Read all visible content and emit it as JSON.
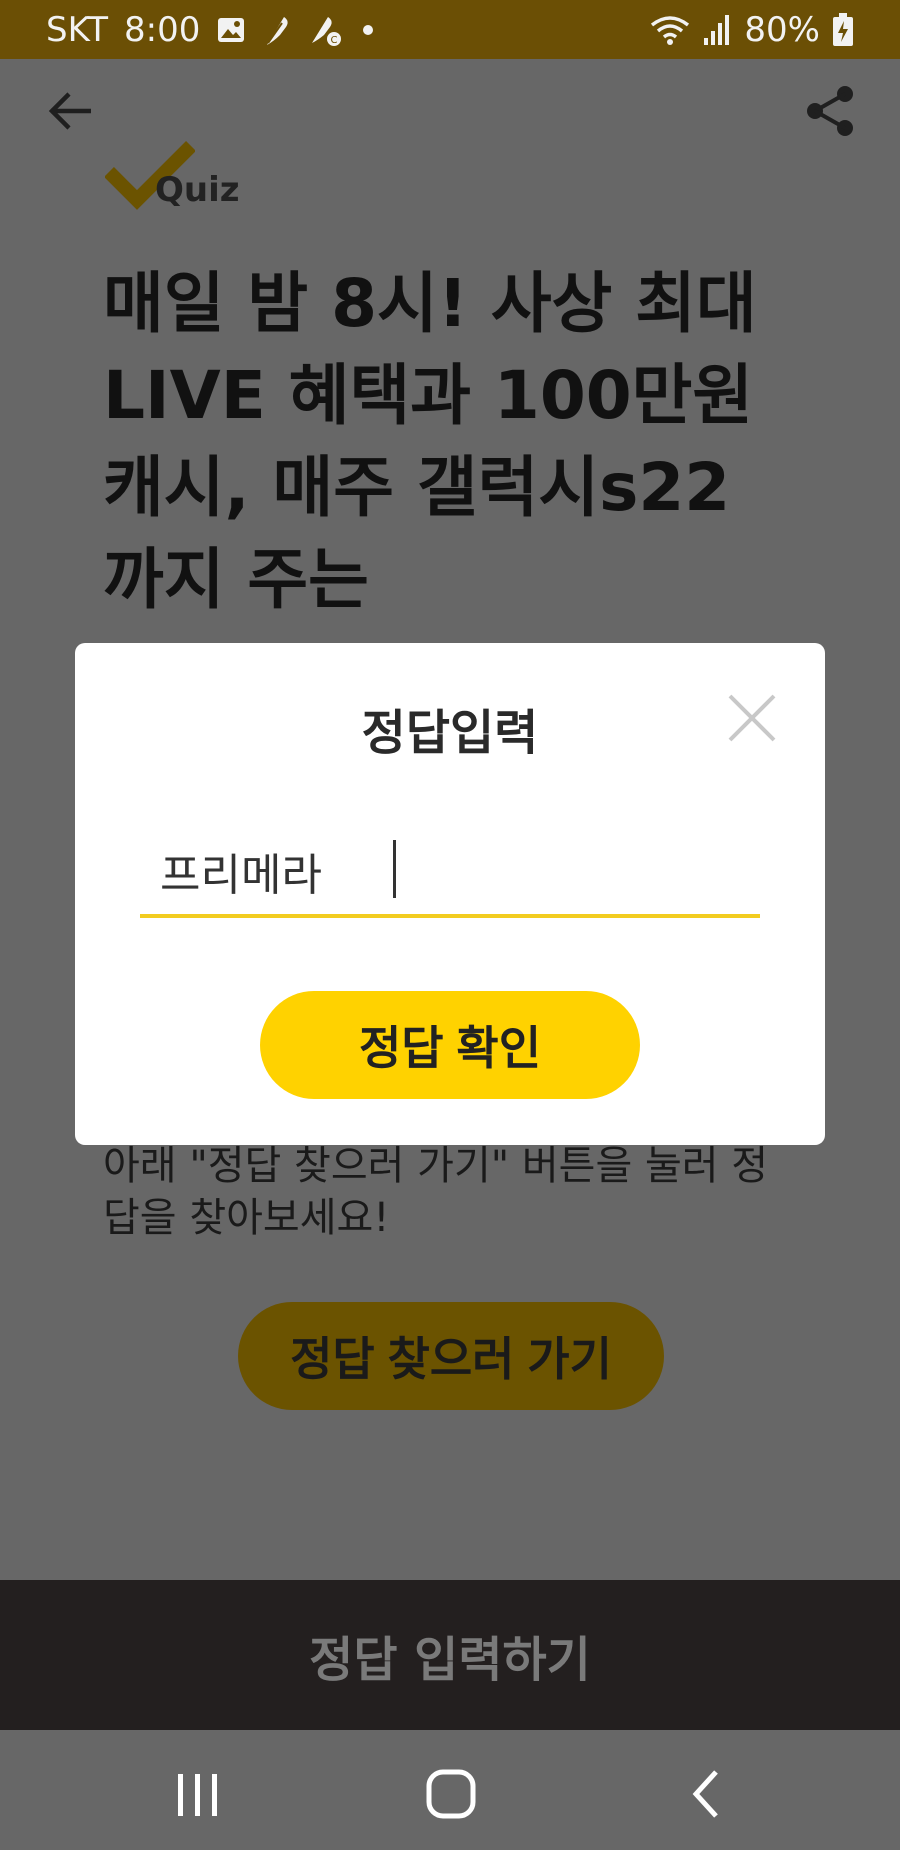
{
  "status_bar": {
    "carrier": "SKT",
    "time": "8:00",
    "battery": "80%",
    "icons": [
      "image-icon",
      "feather-icon",
      "feather-c-icon",
      "dot-icon",
      "wifi-icon",
      "signal-icon",
      "battery-charging-icon"
    ]
  },
  "app_bar": {
    "icons": [
      "back-arrow-icon",
      "share-icon"
    ]
  },
  "logo": {
    "text": "Quiz"
  },
  "main": {
    "title": "매일 밤 8시! 사상 최대 LIVE 혜택과 100만원 캐시, 매주 갤럭시s22까지 주는",
    "description": "아래 \"정답 찾으러 가기\" 버튼을 눌러 정답을 찾아보세요!",
    "find_answer_button": "정답 찾으러 가기"
  },
  "bottom_bar": {
    "label": "정답 입력하기"
  },
  "dialog": {
    "title": "정답입력",
    "answer_value": "프리메라",
    "confirm_button": "정답 확인",
    "close_icon": "close-icon"
  },
  "colors": {
    "status_bar": "#6b4f05",
    "overlay": "#676767",
    "accent_yellow": "#ffd200",
    "input_underline": "#f2cc1f",
    "bottom_bar": "#231f1f"
  }
}
